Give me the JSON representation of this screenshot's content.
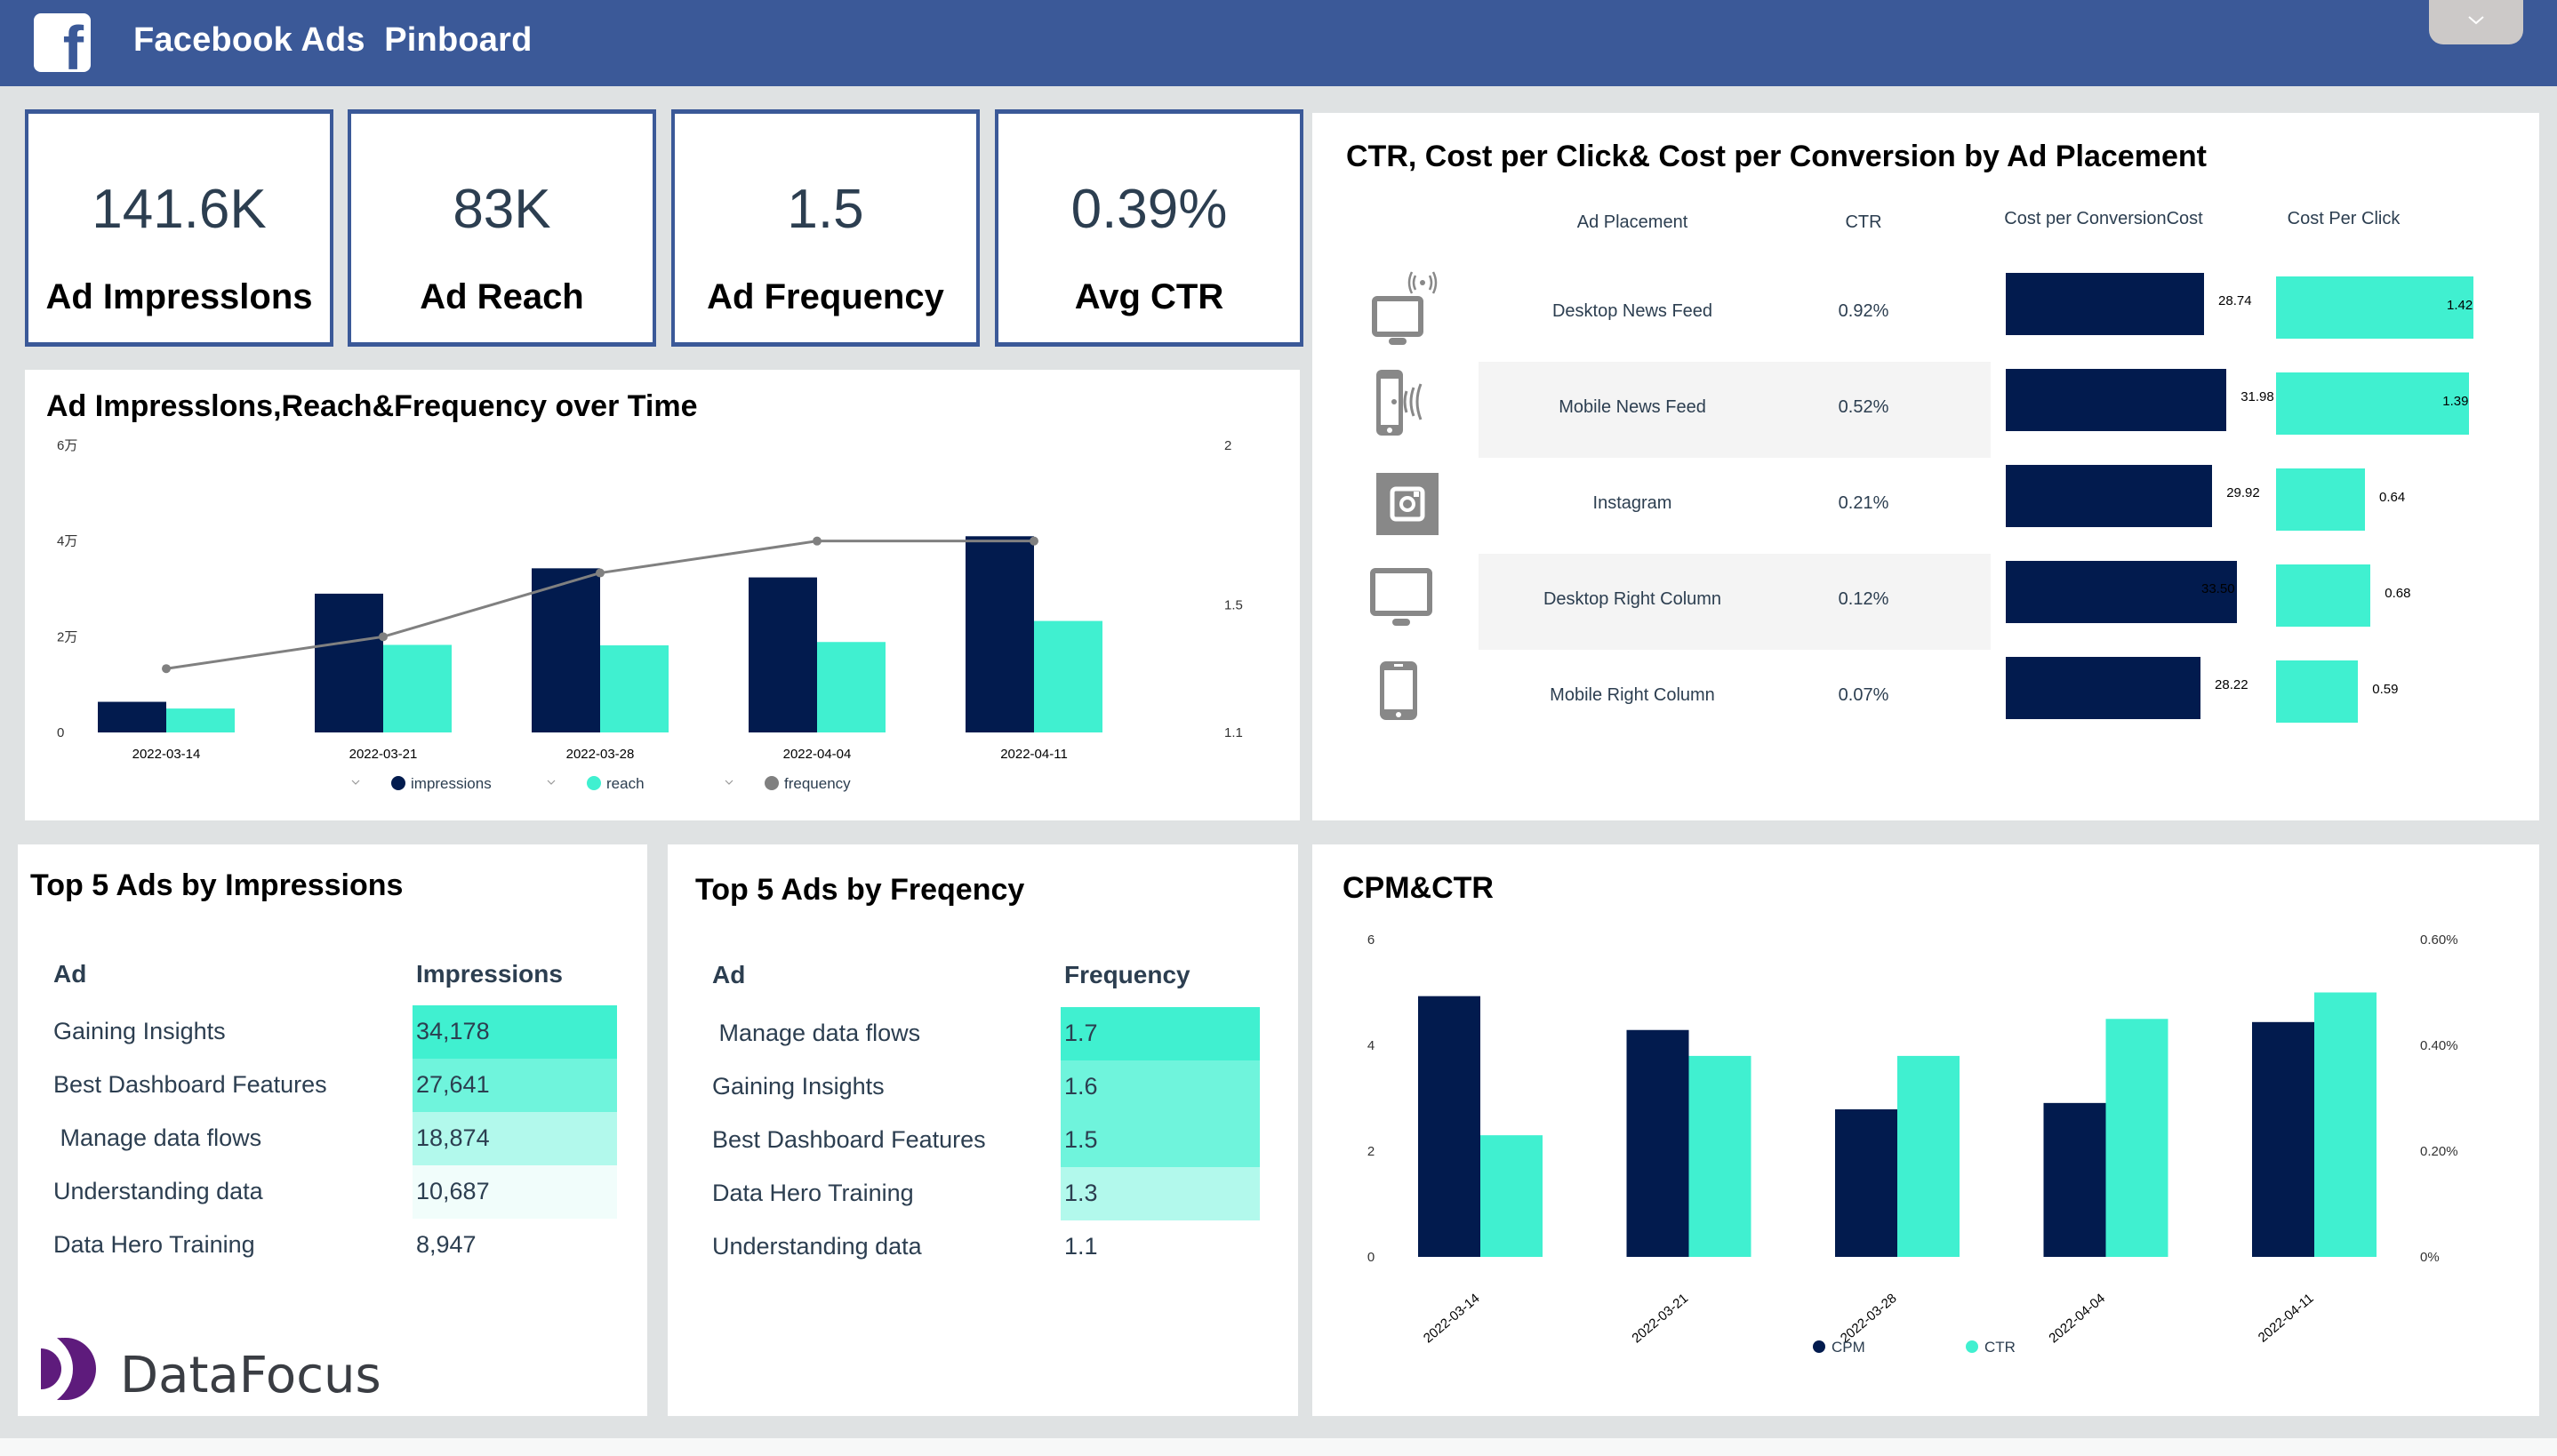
{
  "header": {
    "title": "Facebook Ads  Pinboard",
    "logo_icon": "facebook-icon",
    "menu_icon": "chevron-down-icon"
  },
  "colors": {
    "header_bg": "#3b5998",
    "navy": "#021b4e",
    "teal": "#40f0d0",
    "gray": "#808080",
    "heat_1": "#40f0d0",
    "heat_2": "#6ff4dc",
    "heat_3": "#b2f9ec",
    "heat_4": "#f1fdfb",
    "brand_purple": "#5e1b7c"
  },
  "kpis": [
    {
      "value": "141.6K",
      "label": "Ad Impresslons"
    },
    {
      "value": "83K",
      "label": "Ad Reach"
    },
    {
      "value": "1.5",
      "label": "Ad Frequency"
    },
    {
      "value": "0.39%",
      "label": "Avg CTR"
    }
  ],
  "placement": {
    "title": "CTR, Cost per Click& Cost per Conversion by Ad Placement",
    "headers": {
      "placement": "Ad Placement",
      "ctr": "CTR",
      "cpconv": "Cost per ConversionCost",
      "cpc": "Cost Per Click"
    },
    "rows": [
      {
        "icon": "desktop-wireless-icon",
        "name": "Desktop News Feed",
        "ctr": "0.92%",
        "cpconv": 28.74,
        "cpconv_label": "28.74",
        "cpc": 1.42,
        "cpc_label": "1.42"
      },
      {
        "icon": "mobile-wireless-icon",
        "name": "Mobile News Feed",
        "ctr": "0.52%",
        "cpconv": 31.98,
        "cpconv_label": "31.98",
        "cpc": 1.39,
        "cpc_label": "1.39"
      },
      {
        "icon": "instagram-icon",
        "name": "Instagram",
        "ctr": "0.21%",
        "cpconv": 29.92,
        "cpconv_label": "29.92",
        "cpc": 0.64,
        "cpc_label": "0.64"
      },
      {
        "icon": "desktop-icon",
        "name": "Desktop Right Column",
        "ctr": "0.12%",
        "cpconv": 33.5,
        "cpconv_label": "33.50",
        "cpc": 0.68,
        "cpc_label": "0.68"
      },
      {
        "icon": "mobile-icon",
        "name": "Mobile Right Column",
        "ctr": "0.07%",
        "cpconv": 28.22,
        "cpconv_label": "28.22",
        "cpc": 0.59,
        "cpc_label": "0.59"
      }
    ]
  },
  "top_impressions": {
    "title": "Top 5 Ads by Impressions",
    "headers": {
      "ad": "Ad",
      "value": "Impressions"
    },
    "rows": [
      {
        "ad": "Gaining Insights",
        "value": "34,178",
        "heat": 1
      },
      {
        "ad": "Best Dashboard Features",
        "value": "27,641",
        "heat": 2
      },
      {
        "ad": " Manage data flows",
        "value": "18,874",
        "heat": 3
      },
      {
        "ad": "Understanding data",
        "value": "10,687",
        "heat": 4
      },
      {
        "ad": "Data Hero Training",
        "value": "8,947",
        "heat": 0
      }
    ]
  },
  "top_frequency": {
    "title": "Top 5 Ads by Freqency",
    "headers": {
      "ad": "Ad",
      "value": "Frequency"
    },
    "rows": [
      {
        "ad": " Manage data flows",
        "value": "1.7",
        "heat": 1
      },
      {
        "ad": "Gaining Insights",
        "value": "1.6",
        "heat": 2
      },
      {
        "ad": "Best Dashboard Features",
        "value": "1.5",
        "heat": 2
      },
      {
        "ad": "Data Hero Training",
        "value": "1.3",
        "heat": 3
      },
      {
        "ad": "Understanding data",
        "value": "1.1",
        "heat": 0
      }
    ]
  },
  "brand": {
    "name": "DataFocus"
  },
  "chart_data": [
    {
      "id": "impressions_chart",
      "type": "bar",
      "title": "Ad Impresslons,Reach&Frequency over Time",
      "categories": [
        "2022-03-14",
        "2022-03-21",
        "2022-03-28",
        "2022-04-04",
        "2022-04-11"
      ],
      "series": [
        {
          "name": "impressions",
          "type": "bar",
          "axis": "left",
          "values": [
            6400,
            29000,
            34300,
            32400,
            41000
          ]
        },
        {
          "name": "reach",
          "type": "bar",
          "axis": "left",
          "values": [
            5000,
            18300,
            18200,
            18900,
            23300
          ]
        },
        {
          "name": "frequency",
          "type": "line",
          "axis": "right",
          "values": [
            1.3,
            1.4,
            1.6,
            1.7,
            1.7
          ]
        }
      ],
      "y_left": {
        "ticks": [
          0,
          20000,
          40000,
          60000
        ],
        "tick_labels": [
          "0",
          "2万",
          "4万",
          "6万"
        ],
        "range": [
          0,
          60000
        ]
      },
      "y_right": {
        "ticks": [
          1.1,
          1.5,
          2
        ],
        "tick_labels": [
          "1.1",
          "1.5",
          "2"
        ],
        "range": [
          1.1,
          2
        ]
      },
      "legend": {
        "position": "bottom",
        "items": [
          "impressions",
          "reach",
          "frequency"
        ]
      },
      "grid": false
    },
    {
      "id": "cpm_ctr_chart",
      "type": "bar",
      "title": "CPM&CTR",
      "categories": [
        "2022-03-14",
        "2022-03-21",
        "2022-03-28",
        "2022-04-04",
        "2022-04-11"
      ],
      "series": [
        {
          "name": "CPM",
          "axis": "left",
          "values": [
            4.93,
            4.29,
            2.79,
            2.91,
            4.44
          ]
        },
        {
          "name": "CTR",
          "axis": "right",
          "values": [
            0.23,
            0.38,
            0.38,
            0.45,
            0.5
          ],
          "unit": "%"
        }
      ],
      "y_left": {
        "ticks": [
          0,
          2,
          4,
          6
        ],
        "tick_labels": [
          "0",
          "2",
          "4",
          "6"
        ],
        "range": [
          0,
          6
        ]
      },
      "y_right": {
        "ticks": [
          0,
          0.2,
          0.4,
          0.6
        ],
        "tick_labels": [
          "0%",
          "0.20%",
          "0.40%",
          "0.60%"
        ],
        "range": [
          0,
          0.6
        ]
      },
      "legend": {
        "position": "bottom",
        "items": [
          "CPM",
          "CTR"
        ]
      },
      "x_label_rotation": "diagonal",
      "grid": false
    }
  ]
}
